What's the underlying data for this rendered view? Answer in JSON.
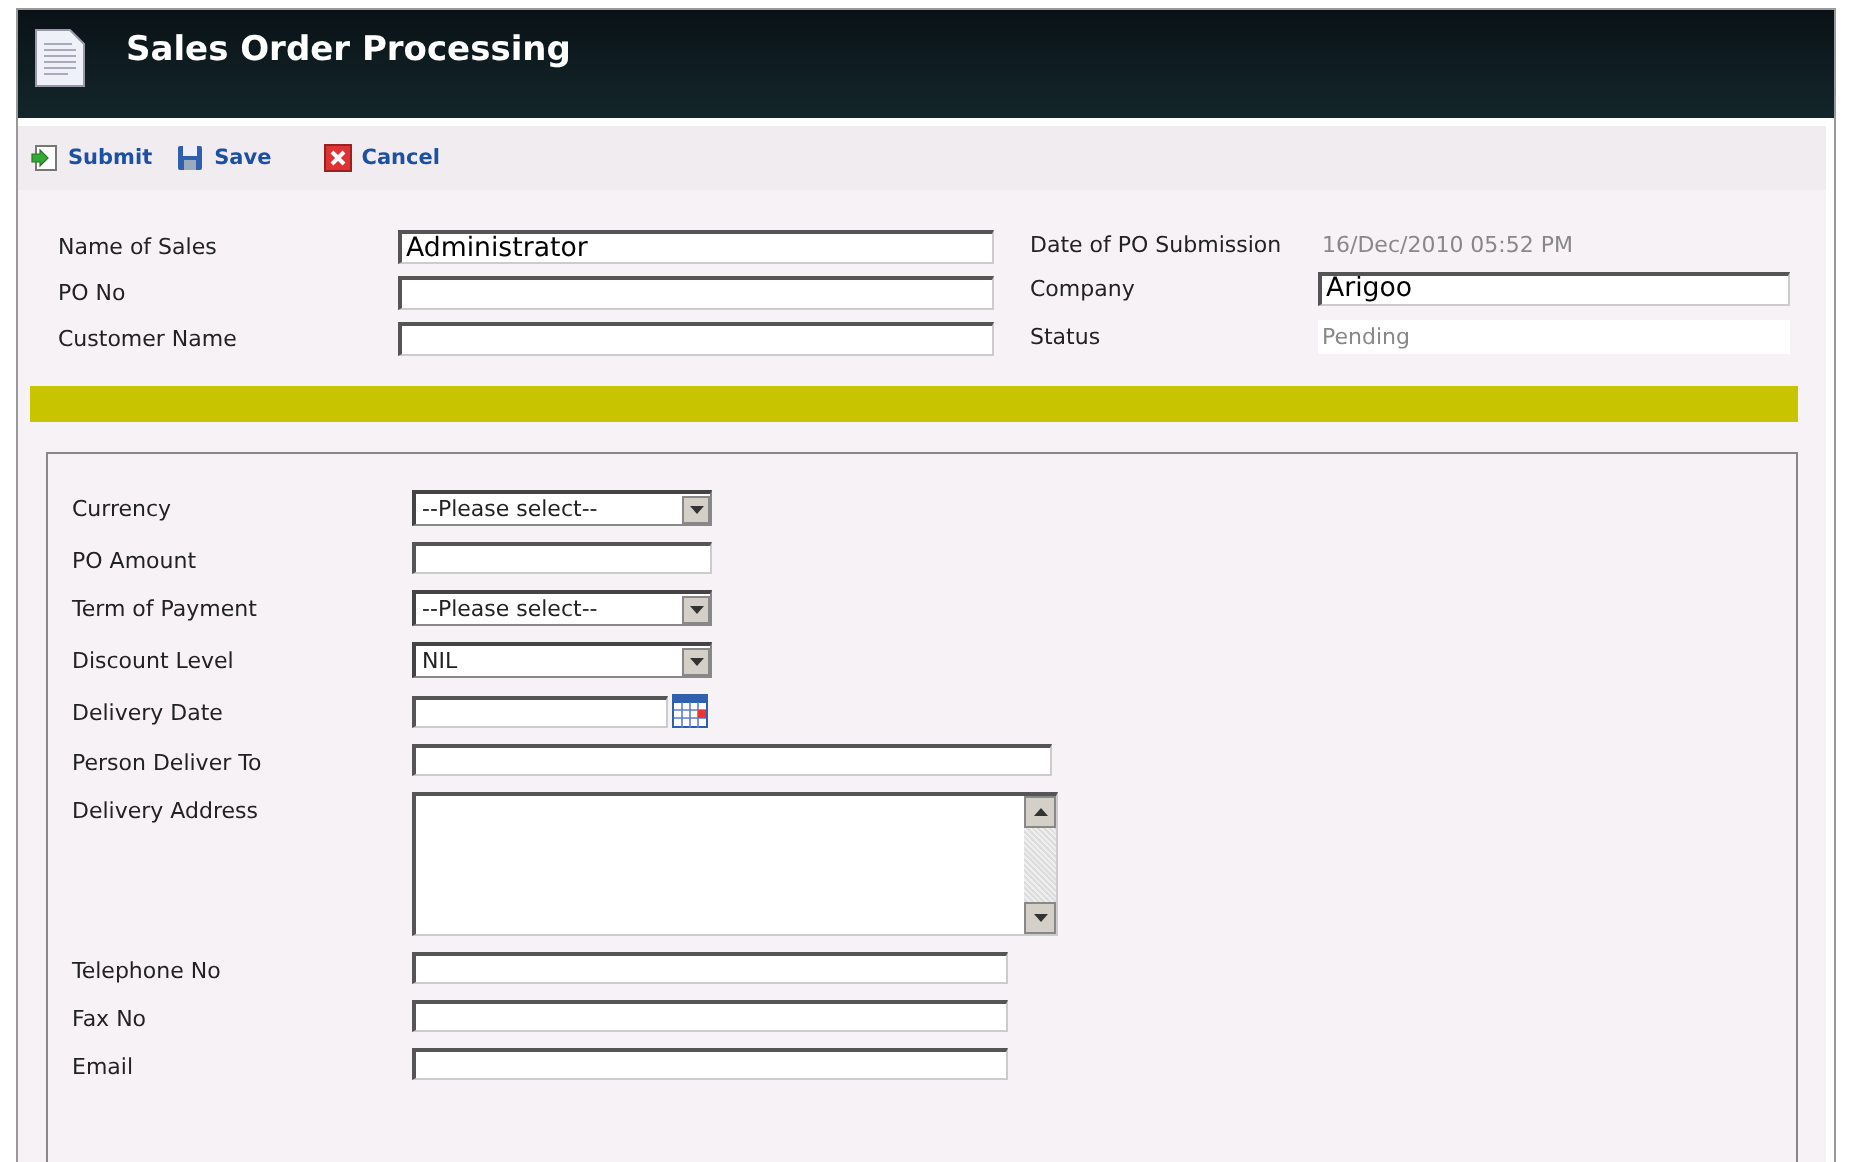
{
  "window": {
    "title": "Sales Order Processing"
  },
  "toolbar": [
    {
      "kind": "submit",
      "label": "Submit"
    },
    {
      "kind": "save",
      "label": "Save"
    },
    {
      "kind": "cancel",
      "label": "Cancel"
    }
  ],
  "header_left": [
    {
      "label": "Name of Sales",
      "value": "Administrator"
    },
    {
      "label": "PO No"
    },
    {
      "label": "Customer Name"
    }
  ],
  "header_right": [
    {
      "kind": "text",
      "label": "Date of PO Submission",
      "value": "16/Dec/2010 05:52 PM"
    },
    {
      "kind": "input",
      "label": "Company",
      "value": "Arigoo"
    },
    {
      "kind": "readonly",
      "label": "Status",
      "value": "Pending"
    }
  ],
  "details": [
    {
      "kind": "select",
      "label": "Currency",
      "value": "--Please select--"
    },
    {
      "kind": "text",
      "label": "PO Amount"
    },
    {
      "kind": "select",
      "label": "Term of Payment",
      "value": "--Please select--"
    },
    {
      "kind": "select",
      "label": "Discount Level",
      "value": "NIL"
    },
    {
      "kind": "date",
      "label": "Delivery Date"
    },
    {
      "kind": "wide",
      "label": "Person Deliver To"
    },
    {
      "kind": "textarea",
      "label": "Delivery Address"
    },
    {
      "kind": "medium",
      "label": "Telephone No"
    },
    {
      "kind": "medium",
      "label": "Fax No"
    },
    {
      "kind": "medium",
      "label": "Email"
    }
  ]
}
